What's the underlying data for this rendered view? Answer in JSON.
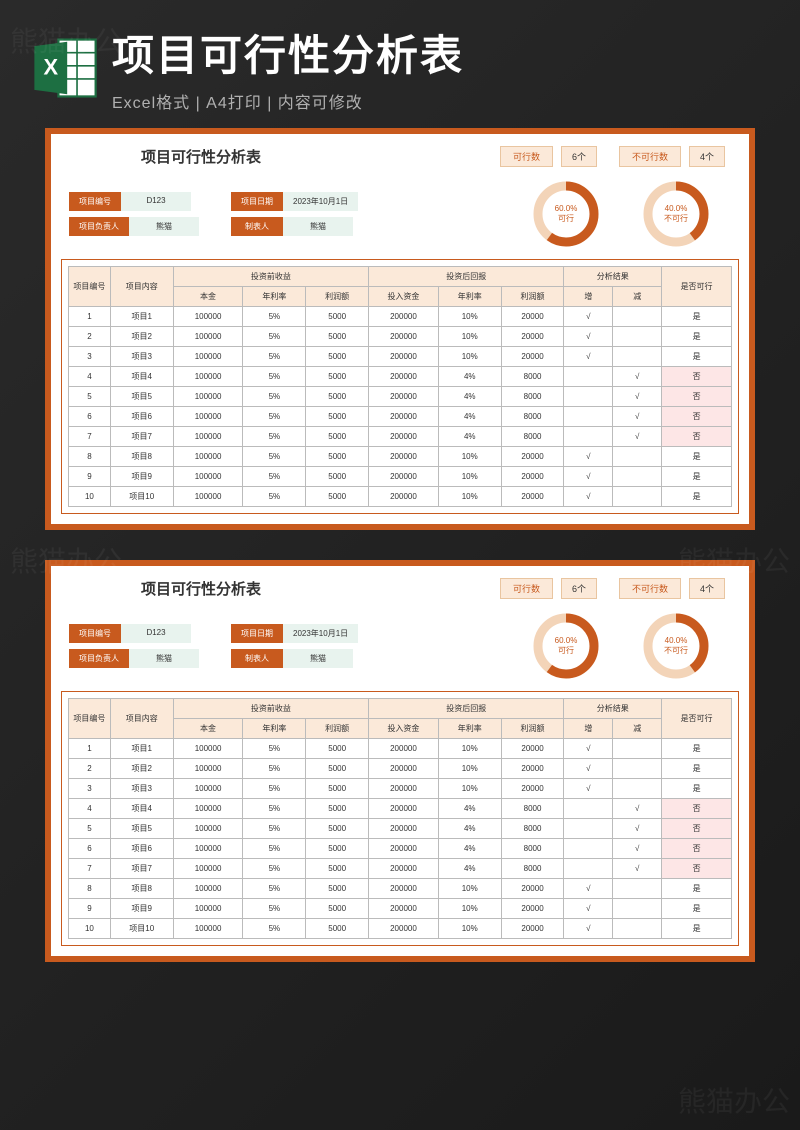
{
  "hero": {
    "title": "项目可行性分析表",
    "subtitle": "Excel格式 | A4打印 | 内容可修改"
  },
  "watermark": "熊猫办公",
  "sheet": {
    "title": "项目可行性分析表",
    "stats": {
      "feasible_label": "可行数",
      "feasible_value": "6个",
      "infeasible_label": "不可行数",
      "infeasible_value": "4个"
    },
    "info": {
      "id_label": "项目编号",
      "id_value": "D123",
      "date_label": "项目日期",
      "date_value": "2023年10月1日",
      "owner_label": "项目负责人",
      "owner_value": "熊猫",
      "maker_label": "制表人",
      "maker_value": "熊猫"
    },
    "chart_data": [
      {
        "type": "pie",
        "title": "可行",
        "percent": 60.0,
        "label": "60.0%",
        "sublabel": "可行",
        "color": "#c85a1e",
        "track": "#f3d4b8"
      },
      {
        "type": "pie",
        "title": "不可行",
        "percent": 40.0,
        "label": "40.0%",
        "sublabel": "不可行",
        "color": "#c85a1e",
        "track": "#f3d4b8"
      }
    ],
    "columns": {
      "c0": "项目编号",
      "c1": "项目内容",
      "g1": "投资前收益",
      "g1a": "本金",
      "g1b": "年利率",
      "g1c": "利润额",
      "g2": "投资后回报",
      "g2a": "投入资金",
      "g2b": "年利率",
      "g2c": "利润额",
      "g3": "分析结果",
      "g3a": "增",
      "g3b": "减",
      "c_last": "是否可行"
    },
    "rows": [
      {
        "n": "1",
        "name": "项目1",
        "principal": "100000",
        "rate1": "5%",
        "profit1": "5000",
        "invest": "200000",
        "rate2": "10%",
        "profit2": "20000",
        "inc": "√",
        "dec": "",
        "ok": "是"
      },
      {
        "n": "2",
        "name": "项目2",
        "principal": "100000",
        "rate1": "5%",
        "profit1": "5000",
        "invest": "200000",
        "rate2": "10%",
        "profit2": "20000",
        "inc": "√",
        "dec": "",
        "ok": "是"
      },
      {
        "n": "3",
        "name": "项目3",
        "principal": "100000",
        "rate1": "5%",
        "profit1": "5000",
        "invest": "200000",
        "rate2": "10%",
        "profit2": "20000",
        "inc": "√",
        "dec": "",
        "ok": "是"
      },
      {
        "n": "4",
        "name": "项目4",
        "principal": "100000",
        "rate1": "5%",
        "profit1": "5000",
        "invest": "200000",
        "rate2": "4%",
        "profit2": "8000",
        "inc": "",
        "dec": "√",
        "ok": "否"
      },
      {
        "n": "5",
        "name": "项目5",
        "principal": "100000",
        "rate1": "5%",
        "profit1": "5000",
        "invest": "200000",
        "rate2": "4%",
        "profit2": "8000",
        "inc": "",
        "dec": "√",
        "ok": "否"
      },
      {
        "n": "6",
        "name": "项目6",
        "principal": "100000",
        "rate1": "5%",
        "profit1": "5000",
        "invest": "200000",
        "rate2": "4%",
        "profit2": "8000",
        "inc": "",
        "dec": "√",
        "ok": "否"
      },
      {
        "n": "7",
        "name": "项目7",
        "principal": "100000",
        "rate1": "5%",
        "profit1": "5000",
        "invest": "200000",
        "rate2": "4%",
        "profit2": "8000",
        "inc": "",
        "dec": "√",
        "ok": "否"
      },
      {
        "n": "8",
        "name": "项目8",
        "principal": "100000",
        "rate1": "5%",
        "profit1": "5000",
        "invest": "200000",
        "rate2": "10%",
        "profit2": "20000",
        "inc": "√",
        "dec": "",
        "ok": "是"
      },
      {
        "n": "9",
        "name": "项目9",
        "principal": "100000",
        "rate1": "5%",
        "profit1": "5000",
        "invest": "200000",
        "rate2": "10%",
        "profit2": "20000",
        "inc": "√",
        "dec": "",
        "ok": "是"
      },
      {
        "n": "10",
        "name": "项目10",
        "principal": "100000",
        "rate1": "5%",
        "profit1": "5000",
        "invest": "200000",
        "rate2": "10%",
        "profit2": "20000",
        "inc": "√",
        "dec": "",
        "ok": "是"
      }
    ]
  }
}
